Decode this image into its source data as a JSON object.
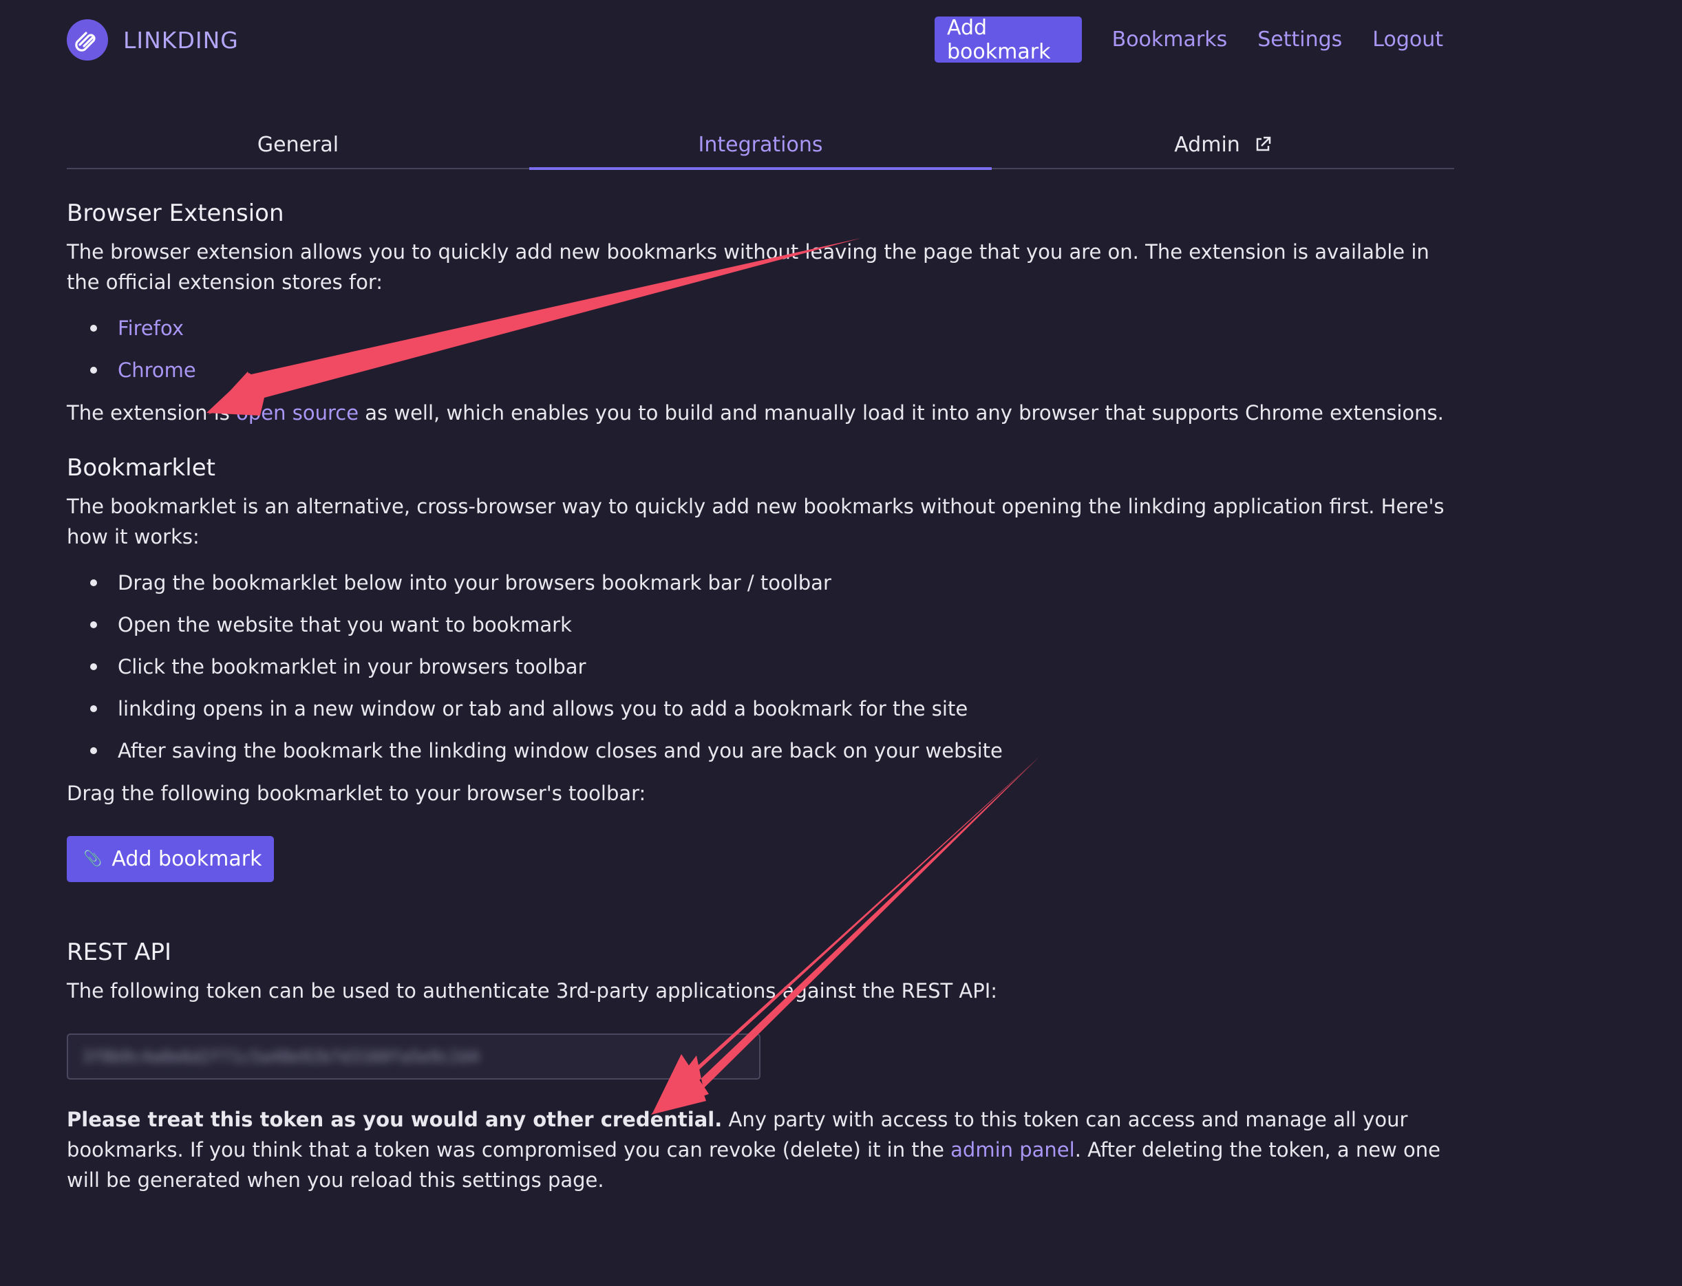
{
  "app": {
    "name": "LINKDING",
    "logo_icon": "paperclip-icon"
  },
  "nav": {
    "add_bookmark": "Add bookmark",
    "bookmarks": "Bookmarks",
    "settings": "Settings",
    "logout": "Logout"
  },
  "tabs": [
    {
      "label": "General",
      "active": false
    },
    {
      "label": "Integrations",
      "active": true
    },
    {
      "label": "Admin",
      "active": false,
      "icon": "external-link-icon"
    }
  ],
  "browser_extension": {
    "heading": "Browser Extension",
    "intro": "The browser extension allows you to quickly add new bookmarks without leaving the page that you are on. The extension is available in the official extension stores for:",
    "stores": [
      "Firefox",
      "Chrome"
    ],
    "open_source_prefix": "The extension is ",
    "open_source_link": "open source",
    "open_source_suffix": " as well, which enables you to build and manually load it into any browser that supports Chrome extensions."
  },
  "bookmarklet": {
    "heading": "Bookmarklet",
    "intro": "The bookmarklet is an alternative, cross-browser way to quickly add new bookmarks without opening the linkding application first. Here's how it works:",
    "steps": [
      "Drag the bookmarklet below into your browsers bookmark bar / toolbar",
      "Open the website that you want to bookmark",
      "Click the bookmarklet in your browsers toolbar",
      "linkding opens in a new window or tab and allows you to add a bookmark for the site",
      "After saving the bookmark the linkding window closes and you are back on your website"
    ],
    "drag_hint": "Drag the following bookmarklet to your browser's toolbar:",
    "button_emoji": "📎",
    "button_label": "Add bookmark"
  },
  "rest_api": {
    "heading": "REST API",
    "intro": "The following token can be used to authenticate 3rd-party applications against the REST API:",
    "token": "3f8b9c4a0e6d2f71c5a48e92b7d3160fa5e9c2d4",
    "warning_bold": "Please treat this token as you would any other credential.",
    "warning_text": " Any party with access to this token can access and manage all your bookmarks. If you think that a token was compromised you can revoke (delete) it in the ",
    "admin_link": "admin panel",
    "warning_end": ". After deleting the token, a new one will be generated when you reload this settings page."
  },
  "colors": {
    "background": "#201e2e",
    "accent": "#6658e6",
    "link": "#a996f5",
    "annotation_arrow": "#f14a63"
  }
}
